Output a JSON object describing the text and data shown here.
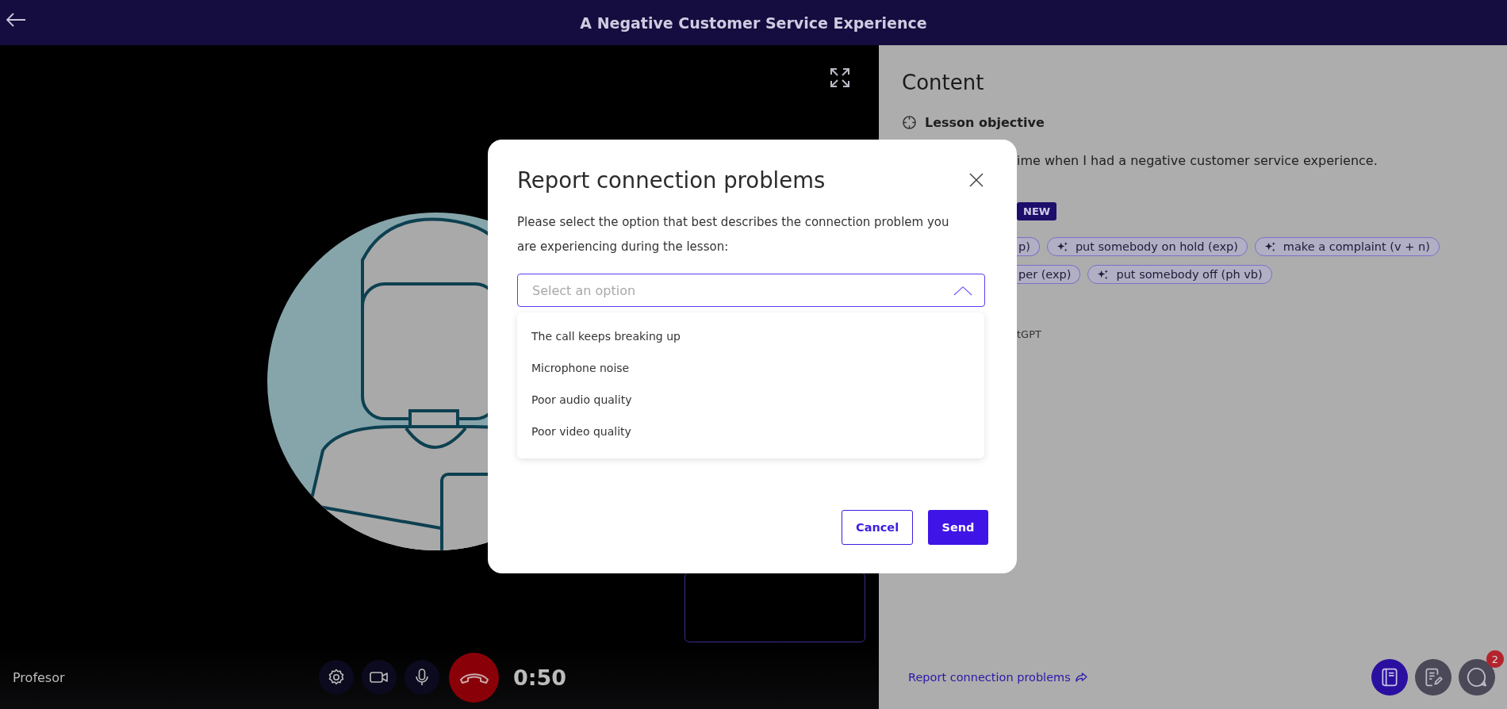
{
  "header": {
    "title": "A Negative Customer Service Experience"
  },
  "video": {
    "participant_name": "Profesor",
    "timer": "0:50"
  },
  "content_panel": {
    "heading": "Content",
    "section_title": "Lesson objective",
    "objective_text": "ime when I had a negative customer service experience.",
    "badge": "NEW",
    "chip_rows": [
      {
        "chips": [
          {
            "label": "p)",
            "cut": true
          },
          {
            "label": "put somebody on hold (exp)",
            "cut": false
          },
          {
            "label": "make a complaint (v + n)",
            "cut": false
          }
        ]
      },
      {
        "chips": [
          {
            "label": "per (exp)",
            "cut": true
          },
          {
            "label": "put somebody off (ph vb)",
            "cut": false
          }
        ]
      }
    ],
    "footnote": "tGPT",
    "report_link": "Report connection problems"
  },
  "side_buttons": [
    {
      "kind": "book",
      "selected": true
    },
    {
      "kind": "notes",
      "selected": false
    },
    {
      "kind": "chat",
      "selected": false,
      "badge": "2"
    }
  ],
  "dialog": {
    "title": "Report connection problems",
    "description": "Please select the option that best describes the connection problem you are experiencing during the lesson:",
    "select": {
      "placeholder": "Select an option",
      "expanded": true
    },
    "options": [
      "The call keeps breaking up",
      "Microphone noise",
      "Poor audio quality",
      "Poor video quality"
    ],
    "buttons": [
      {
        "label": "Cancel",
        "kind": "secondary"
      },
      {
        "label": "Send",
        "kind": "primary"
      }
    ]
  }
}
